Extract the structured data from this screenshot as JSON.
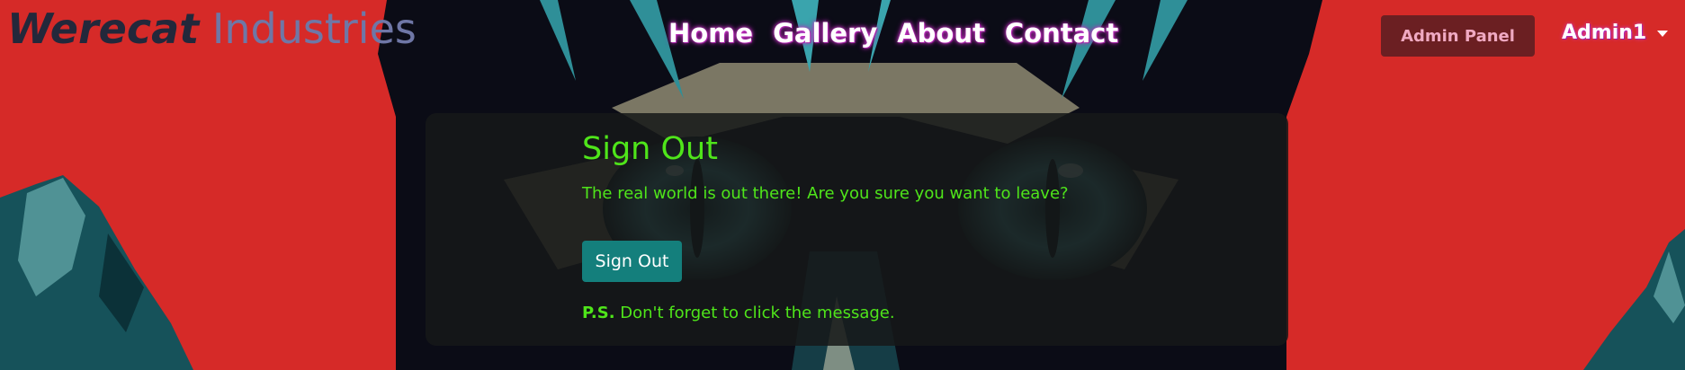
{
  "brand": {
    "part1": "Werecat",
    "part2": "Industries"
  },
  "nav": {
    "items": [
      {
        "label": "Home"
      },
      {
        "label": "Gallery"
      },
      {
        "label": "About"
      },
      {
        "label": "Contact"
      }
    ]
  },
  "admin_panel_label": "Admin Panel",
  "user_menu": {
    "username": "Admin1",
    "icon": "caret-down-icon"
  },
  "card": {
    "title": "Sign Out",
    "message": "The real world is out there! Are you sure you want to leave?",
    "button_label": "Sign Out",
    "ps_label": "P.S.",
    "ps_text": " Don't forget to click the message."
  },
  "colors": {
    "background": "#d62a28",
    "accent_green": "#4fe51a",
    "button_teal": "#147f7c",
    "admin_button": "#6b1f22"
  }
}
